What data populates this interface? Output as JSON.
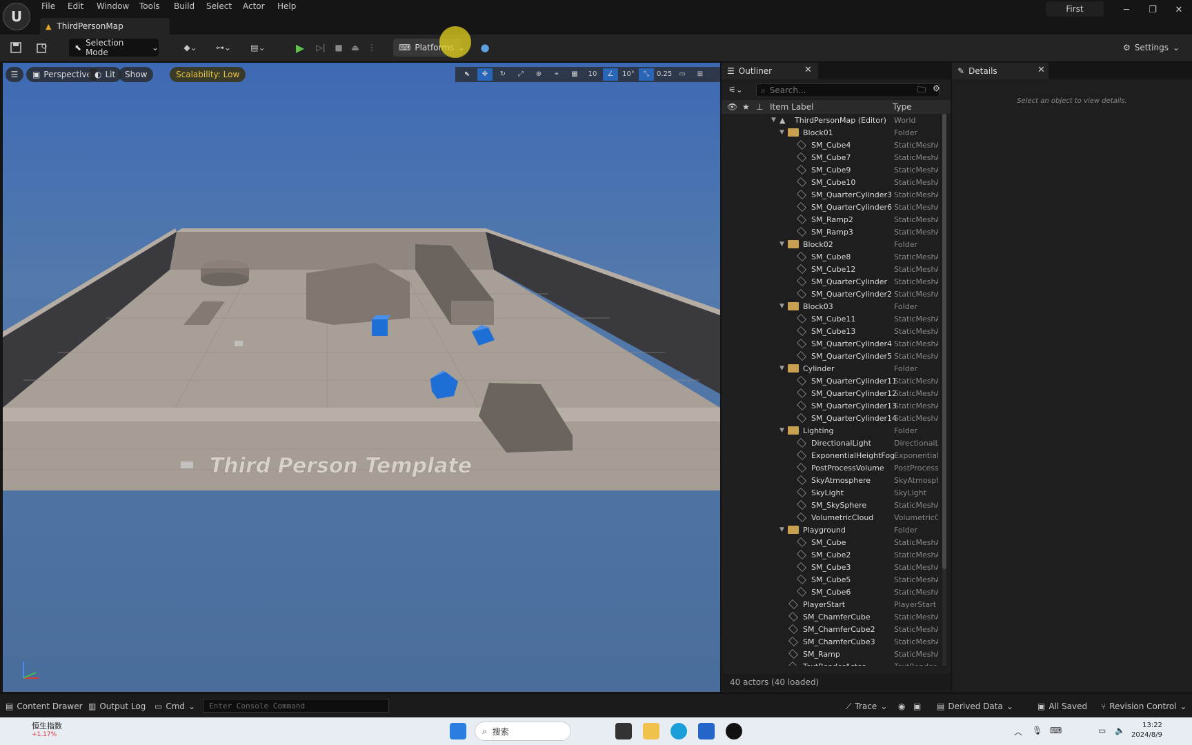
{
  "menubar": {
    "items": [
      "File",
      "Edit",
      "Window",
      "Tools",
      "Build",
      "Select",
      "Actor",
      "Help"
    ],
    "doc_tab": "ThirdPersonMap",
    "profile": "First",
    "window_controls": [
      "minimize-icon",
      "restore-icon",
      "close-icon"
    ]
  },
  "toolbar": {
    "selection_mode": "Selection Mode",
    "platforms": "Platforms",
    "settings": "Settings",
    "icons": [
      "save-icon",
      "browse-icon",
      "add-actor-icon",
      "blueprint-icon",
      "cinematics-icon",
      "play-icon",
      "advance-frame-icon",
      "stop-icon",
      "eject-icon",
      "more-icon",
      "platforms-icon",
      "globe-icon",
      "gear-icon"
    ]
  },
  "viewport": {
    "perspective": "Perspective",
    "lit": "Lit",
    "show": "Show",
    "scalability": "Scalability: Low",
    "floor_text": "Third Person Template",
    "tools": [
      "10",
      "10°",
      "0.25"
    ],
    "sky_color": "#4a6fa6",
    "floor_color": "#a89f97",
    "cube_color": "#1d6fd6"
  },
  "outliner": {
    "tab": "Outliner",
    "search_placeholder": "Search...",
    "col_label": "Item Label",
    "col_type": "Type",
    "footer": "40 actors (40 loaded)",
    "rows": [
      {
        "label": "ThirdPersonMap (Editor)",
        "type": "World",
        "depth": 0,
        "kind": "world",
        "expanded": true
      },
      {
        "label": "Block01",
        "type": "Folder",
        "depth": 1,
        "kind": "folder",
        "expanded": true
      },
      {
        "label": "SM_Cube4",
        "type": "StaticMeshA",
        "depth": 2,
        "kind": "mesh"
      },
      {
        "label": "SM_Cube7",
        "type": "StaticMeshA",
        "depth": 2,
        "kind": "mesh"
      },
      {
        "label": "SM_Cube9",
        "type": "StaticMeshA",
        "depth": 2,
        "kind": "mesh"
      },
      {
        "label": "SM_Cube10",
        "type": "StaticMeshA",
        "depth": 2,
        "kind": "mesh"
      },
      {
        "label": "SM_QuarterCylinder3",
        "type": "StaticMeshA",
        "depth": 2,
        "kind": "mesh"
      },
      {
        "label": "SM_QuarterCylinder6",
        "type": "StaticMeshA",
        "depth": 2,
        "kind": "mesh"
      },
      {
        "label": "SM_Ramp2",
        "type": "StaticMeshA",
        "depth": 2,
        "kind": "mesh"
      },
      {
        "label": "SM_Ramp3",
        "type": "StaticMeshA",
        "depth": 2,
        "kind": "mesh"
      },
      {
        "label": "Block02",
        "type": "Folder",
        "depth": 1,
        "kind": "folder",
        "expanded": true
      },
      {
        "label": "SM_Cube8",
        "type": "StaticMeshA",
        "depth": 2,
        "kind": "mesh"
      },
      {
        "label": "SM_Cube12",
        "type": "StaticMeshA",
        "depth": 2,
        "kind": "mesh"
      },
      {
        "label": "SM_QuarterCylinder",
        "type": "StaticMeshA",
        "depth": 2,
        "kind": "mesh"
      },
      {
        "label": "SM_QuarterCylinder2",
        "type": "StaticMeshA",
        "depth": 2,
        "kind": "mesh"
      },
      {
        "label": "Block03",
        "type": "Folder",
        "depth": 1,
        "kind": "folder",
        "expanded": true
      },
      {
        "label": "SM_Cube11",
        "type": "StaticMeshA",
        "depth": 2,
        "kind": "mesh"
      },
      {
        "label": "SM_Cube13",
        "type": "StaticMeshA",
        "depth": 2,
        "kind": "mesh"
      },
      {
        "label": "SM_QuarterCylinder4",
        "type": "StaticMeshA",
        "depth": 2,
        "kind": "mesh"
      },
      {
        "label": "SM_QuarterCylinder5",
        "type": "StaticMeshA",
        "depth": 2,
        "kind": "mesh"
      },
      {
        "label": "Cylinder",
        "type": "Folder",
        "depth": 1,
        "kind": "folder",
        "expanded": true
      },
      {
        "label": "SM_QuarterCylinder11",
        "type": "StaticMeshA",
        "depth": 2,
        "kind": "mesh"
      },
      {
        "label": "SM_QuarterCylinder12",
        "type": "StaticMeshA",
        "depth": 2,
        "kind": "mesh"
      },
      {
        "label": "SM_QuarterCylinder13",
        "type": "StaticMeshA",
        "depth": 2,
        "kind": "mesh"
      },
      {
        "label": "SM_QuarterCylinder14",
        "type": "StaticMeshA",
        "depth": 2,
        "kind": "mesh"
      },
      {
        "label": "Lighting",
        "type": "Folder",
        "depth": 1,
        "kind": "folder",
        "expanded": true
      },
      {
        "label": "DirectionalLight",
        "type": "DirectionalLi",
        "depth": 2,
        "kind": "light"
      },
      {
        "label": "ExponentialHeightFog",
        "type": "Exponentiall",
        "depth": 2,
        "kind": "fog"
      },
      {
        "label": "PostProcessVolume",
        "type": "PostProcess",
        "depth": 2,
        "kind": "volume"
      },
      {
        "label": "SkyAtmosphere",
        "type": "SkyAtmosph",
        "depth": 2,
        "kind": "sky"
      },
      {
        "label": "SkyLight",
        "type": "SkyLight",
        "depth": 2,
        "kind": "sky"
      },
      {
        "label": "SM_SkySphere",
        "type": "StaticMeshA",
        "depth": 2,
        "kind": "mesh"
      },
      {
        "label": "VolumetricCloud",
        "type": "VolumetricC",
        "depth": 2,
        "kind": "sky"
      },
      {
        "label": "Playground",
        "type": "Folder",
        "depth": 1,
        "kind": "folder",
        "expanded": true
      },
      {
        "label": "SM_Cube",
        "type": "StaticMeshA",
        "depth": 2,
        "kind": "mesh"
      },
      {
        "label": "SM_Cube2",
        "type": "StaticMeshA",
        "depth": 2,
        "kind": "mesh"
      },
      {
        "label": "SM_Cube3",
        "type": "StaticMeshA",
        "depth": 2,
        "kind": "mesh"
      },
      {
        "label": "SM_Cube5",
        "type": "StaticMeshA",
        "depth": 2,
        "kind": "mesh"
      },
      {
        "label": "SM_Cube6",
        "type": "StaticMeshA",
        "depth": 2,
        "kind": "mesh"
      },
      {
        "label": "PlayerStart",
        "type": "PlayerStart",
        "depth": 1,
        "kind": "player"
      },
      {
        "label": "SM_ChamferCube",
        "type": "StaticMeshA",
        "depth": 1,
        "kind": "mesh"
      },
      {
        "label": "SM_ChamferCube2",
        "type": "StaticMeshA",
        "depth": 1,
        "kind": "mesh"
      },
      {
        "label": "SM_ChamferCube3",
        "type": "StaticMeshA",
        "depth": 1,
        "kind": "mesh"
      },
      {
        "label": "SM_Ramp",
        "type": "StaticMeshA",
        "depth": 1,
        "kind": "mesh"
      },
      {
        "label": "TextRenderActor",
        "type": "TextRender",
        "depth": 1,
        "kind": "text"
      }
    ]
  },
  "details": {
    "tab": "Details",
    "empty": "Select an object to view details."
  },
  "statusbar": {
    "content_drawer": "Content Drawer",
    "output_log": "Output Log",
    "cmd": "Cmd",
    "console_placeholder": "Enter Console Command",
    "trace": "Trace",
    "derived_data": "Derived Data",
    "all_saved": "All Saved",
    "revision_control": "Revision Control"
  },
  "taskbar": {
    "stock_name": "恒生指数",
    "stock_change": "+1.17%",
    "search": "搜索",
    "time": "13:22",
    "date": "2024/8/9"
  }
}
